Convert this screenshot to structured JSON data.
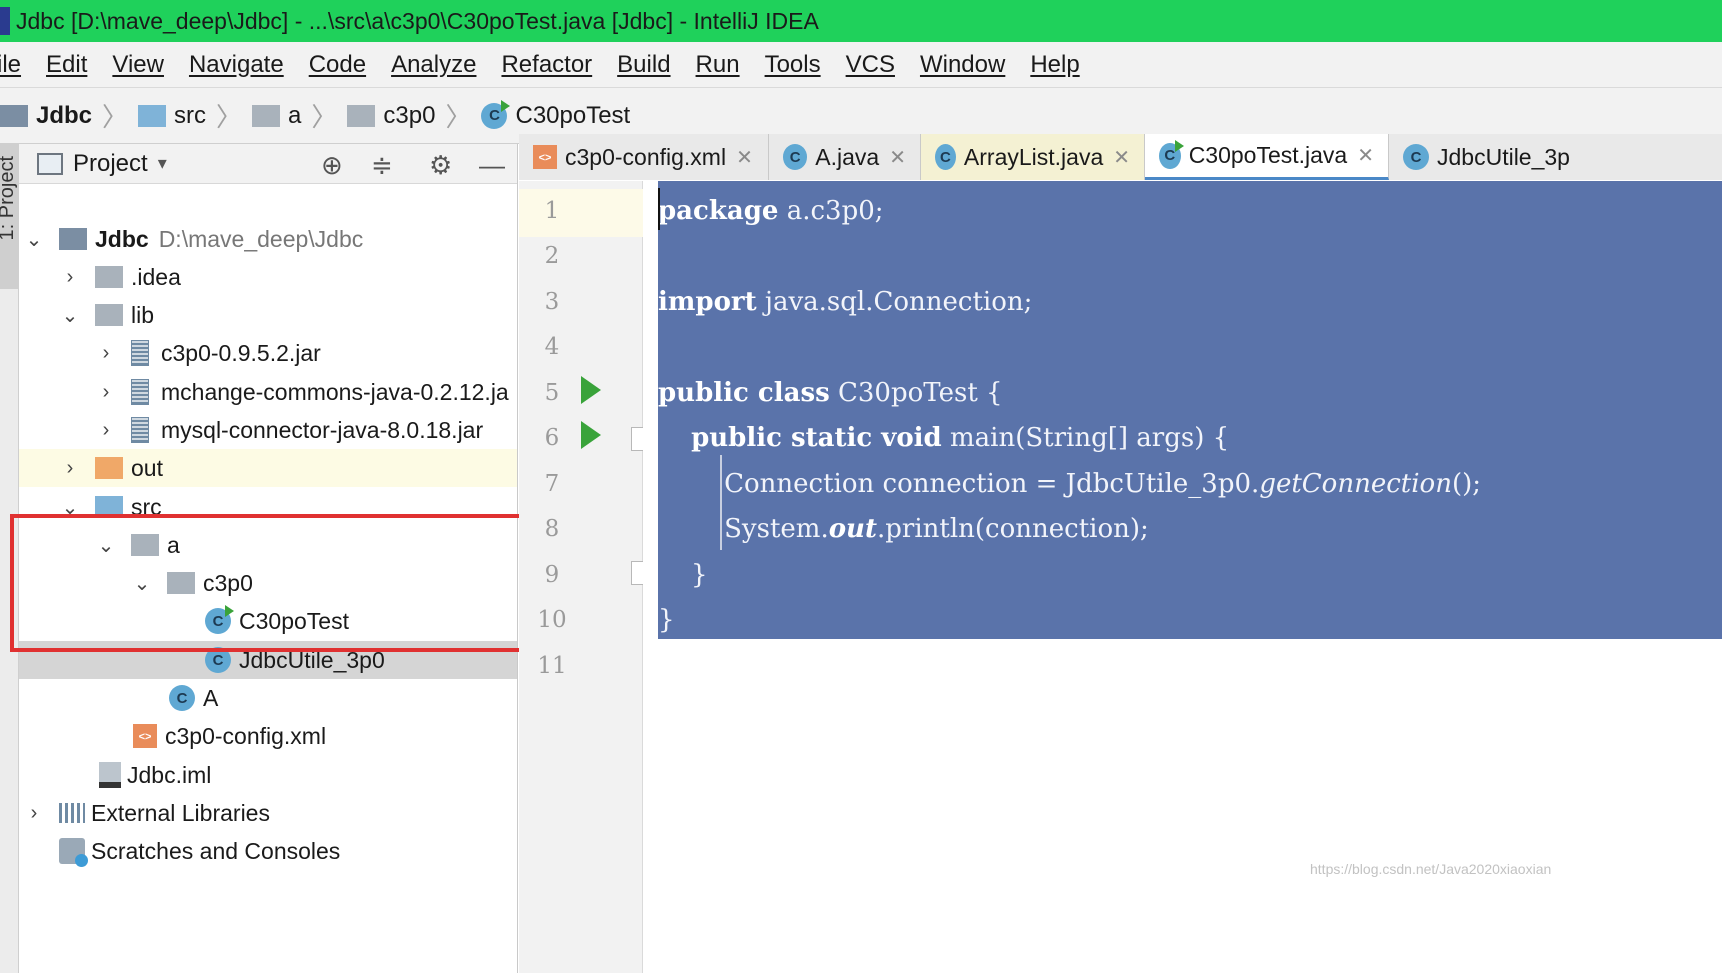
{
  "window": {
    "title": "Jdbc [D:\\mave_deep\\Jdbc] - ...\\src\\a\\c3p0\\C30poTest.java [Jdbc] - IntelliJ IDEA"
  },
  "menu": [
    "ile",
    "Edit",
    "View",
    "Navigate",
    "Code",
    "Analyze",
    "Refactor",
    "Build",
    "Run",
    "Tools",
    "VCS",
    "Window",
    "Help"
  ],
  "breadcrumb": [
    "Jdbc",
    "src",
    "a",
    "c3p0",
    "C30poTest"
  ],
  "side_tab": "1: Project",
  "project_panel": {
    "title": "Project",
    "dropdown": "▾"
  },
  "tree": [
    {
      "label": "Jdbc",
      "extra": "D:\\mave_deep\\Jdbc"
    },
    {
      "label": ".idea"
    },
    {
      "label": "lib"
    },
    {
      "label": "c3p0-0.9.5.2.jar"
    },
    {
      "label": "mchange-commons-java-0.2.12.ja"
    },
    {
      "label": "mysql-connector-java-8.0.18.jar"
    },
    {
      "label": "out"
    },
    {
      "label": "src"
    },
    {
      "label": "a"
    },
    {
      "label": "c3p0"
    },
    {
      "label": "C30poTest"
    },
    {
      "label": "JdbcUtile_3p0"
    },
    {
      "label": "A"
    },
    {
      "label": "c3p0-config.xml"
    },
    {
      "label": "Jdbc.iml"
    },
    {
      "label": "External Libraries"
    },
    {
      "label": "Scratches and Consoles"
    }
  ],
  "tabs": [
    {
      "label": "c3p0-config.xml"
    },
    {
      "label": "A.java"
    },
    {
      "label": "ArrayList.java"
    },
    {
      "label": "C30poTest.java"
    },
    {
      "label": "JdbcUtile_3p"
    }
  ],
  "line_numbers": [
    "1",
    "2",
    "3",
    "4",
    "5",
    "6",
    "7",
    "8",
    "9",
    "10",
    "11"
  ],
  "code": {
    "l1_kw": "package",
    "l1_rest": " a.c3p0;",
    "l3_kw": "import",
    "l3_rest": " java.sql.Connection;",
    "l5_kw": "public class",
    "l5_rest": " C30poTest {",
    "l6_indent": "    ",
    "l6_kw": "public static void",
    "l6_rest": " main(String[] args) {",
    "l7_a": "        Connection connection = JdbcUtile_3p0.",
    "l7_it": "getConnection",
    "l7_b": "();",
    "l8_a": "        System.",
    "l8_it": "out",
    "l8_b": ".println(connection);",
    "l9": "    }",
    "l10": "}"
  },
  "watermark": "https://blog.csdn.net/Java2020xiaoxian",
  "colors": {
    "titlebar": "#1fd15b",
    "selection": "#5a73aa",
    "highlight_box": "#e03131",
    "run": "#39a33a"
  }
}
